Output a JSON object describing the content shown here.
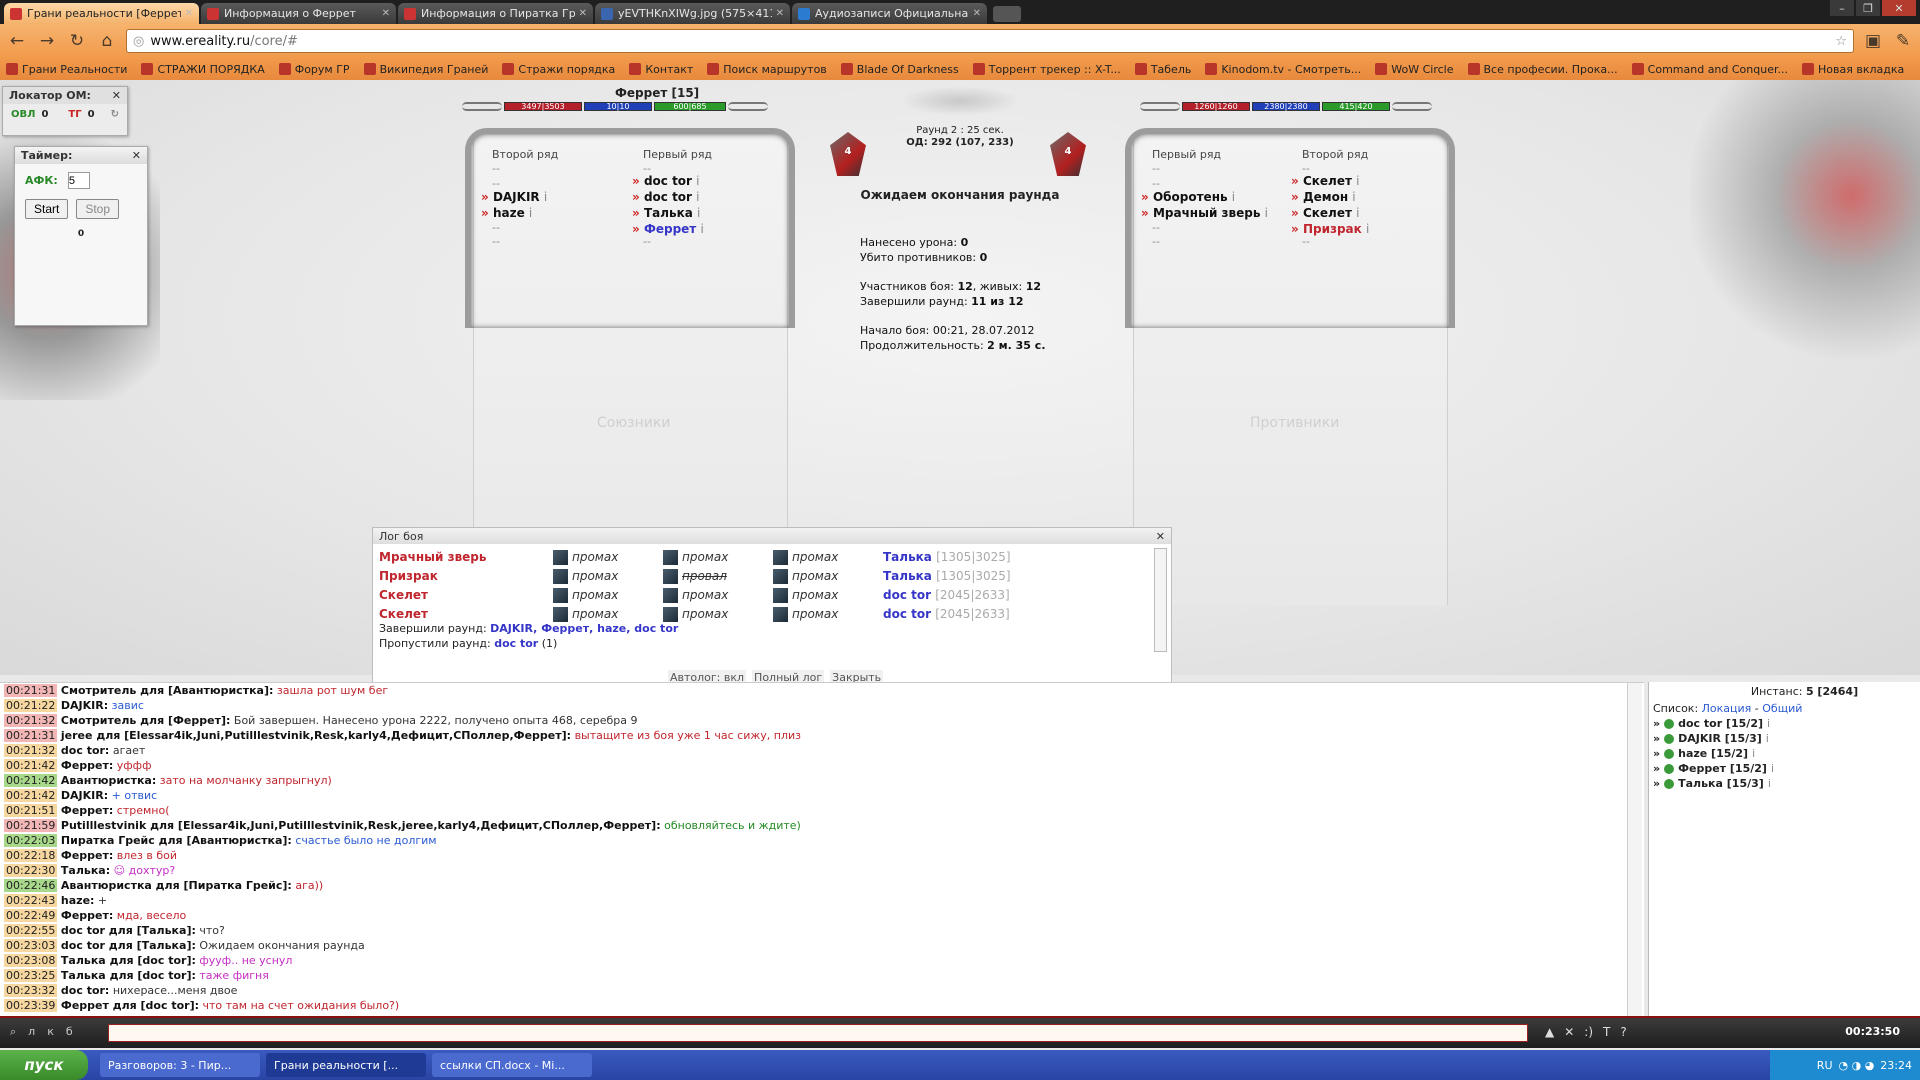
{
  "browser": {
    "tabs": [
      {
        "label": "Грани реальности [Феррет]",
        "active": true,
        "icon": "grani-favicon"
      },
      {
        "label": "Информация о Феррет",
        "active": false,
        "icon": "grani-favicon"
      },
      {
        "label": "Информация о Пиратка Гр",
        "active": false,
        "icon": "grani-favicon"
      },
      {
        "label": "yEVTHKnXIWg.jpg (575×411",
        "active": false,
        "icon": "vk-favicon"
      },
      {
        "label": "Аудиозаписи Официальная",
        "active": false,
        "icon": "vk-favicon"
      }
    ],
    "url_host": "www.ereality.ru",
    "url_path": "/core/#",
    "bookmarks": [
      "Грани Реальности",
      "СТРАЖИ ПОРЯДКА",
      "Форум ГР",
      "Википедия Граней",
      "Стражи порядка",
      "Контакт",
      "Поиск маршрутов",
      "Blade Of Darkness",
      "Торрент трекер :: X-T...",
      "Табель",
      "Kinodom.tv - Смотреть...",
      "WoW Circle",
      "Все професии. Прока...",
      "Command and Conquer...",
      "Новая вкладка"
    ]
  },
  "locator": {
    "title": "Локатор ОМ:",
    "ovl_label": "ОВЛ",
    "ovl_value": "0",
    "tg_label": "ТГ",
    "tg_value": "0"
  },
  "timer": {
    "title": "Таймер:",
    "afk_label": "АФК:",
    "afk_value": "5",
    "start": "Start",
    "stop": "Stop",
    "counter": "0"
  },
  "battle": {
    "player_title": "Феррет [15]",
    "left_bars": {
      "hp": "3497|3503",
      "mana": "10|10",
      "energy": "600|685"
    },
    "right_bars": {
      "hp": "1260|1260",
      "mana": "2380|2380",
      "energy": "415|420"
    },
    "team_left_count": "4",
    "team_right_count": "4",
    "round_line": "Раунд 2 : 25 сек.",
    "od_line": "ОД: 292 (107, 233)",
    "status": "Ожидаем окончания раунда",
    "stats": {
      "damage_label": "Нанесено урона:",
      "damage": "0",
      "kills_label": "Убито противников:",
      "kills": "0",
      "participants_label": "Участников боя:",
      "participants": "12",
      "alive_label": ", живых:",
      "alive": "12",
      "finished_label": "Завершили раунд:",
      "finished": "11 из 12",
      "start_label": "Начало боя:",
      "start": "00:21, 28.07.2012",
      "duration_label": "Продолжительность:",
      "duration": "2 м. 35 с."
    },
    "allies": {
      "second_row": "Второй ряд",
      "first_row": "Первый ряд",
      "second": [
        "--",
        "--",
        "DAJKIR",
        "haze",
        "--",
        "--"
      ],
      "first": [
        "--",
        "doc tor",
        "doc tor",
        "Талька",
        "Феррет",
        "--"
      ],
      "watermark": "Союзники"
    },
    "enemies": {
      "first_row": "Первый ряд",
      "second_row": "Второй ряд",
      "first": [
        "--",
        "--",
        "Оборотень",
        "Мрачный зверь",
        "--",
        "--"
      ],
      "second": [
        "--",
        "Скелет",
        "Демон",
        "Скелет",
        "Призрак",
        "--"
      ],
      "watermark": "Противники"
    }
  },
  "log": {
    "title": "Лог боя",
    "rows": [
      {
        "name": "Мрачный зверь",
        "a": "промах",
        "b": "промах",
        "c": "промах",
        "target": "Талька",
        "hp": "[1305|3025]"
      },
      {
        "name": "Призрак",
        "a": "промах",
        "b": "провал",
        "c": "промах",
        "target": "Талька",
        "hp": "[1305|3025]"
      },
      {
        "name": "Скелет",
        "a": "промах",
        "b": "промах",
        "c": "промах",
        "target": "doc tor",
        "hp": "[2045|2633]"
      },
      {
        "name": "Скелет",
        "a": "промах",
        "b": "промах",
        "c": "промах",
        "target": "doc tor",
        "hp": "[2045|2633]"
      }
    ],
    "finished_label": "Завершили раунд:",
    "finished_names": "DAJKIR, Феррет, haze, doc tor",
    "skipped_label": "Пропустили раунд:",
    "skipped_names": "doc tor",
    "skipped_count": "(1)",
    "footer": [
      "Автолог: вкл",
      "Полный лог",
      "Закрыть"
    ]
  },
  "chat": [
    {
      "t": "00:21:31",
      "c": "r",
      "n": "Смотритель для [Авантюристка]:",
      "m": "зашла рот шум бег",
      "k": ""
    },
    {
      "t": "00:21:22",
      "c": "",
      "n": "DAJKIR:",
      "m": "завис",
      "k": "b"
    },
    {
      "t": "00:21:32",
      "c": "r",
      "n": "Смотритель для [Феррет]:",
      "m": "Бой завершен. Нанесено урона 2222, получено опыта 468, серебра 9",
      "k": "d"
    },
    {
      "t": "00:21:31",
      "c": "r",
      "n": "jeree для [Elessar4ik,Juni,Putilllestvinik,Resk,karly4,Дефицит,СПоллер,Феррет]:",
      "m": "вытащите из боя уже 1 час сижу, плиз",
      "k": ""
    },
    {
      "t": "00:21:32",
      "c": "",
      "n": "doc tor:",
      "m": "агает",
      "k": "d"
    },
    {
      "t": "00:21:42",
      "c": "",
      "n": "Феррет:",
      "m": "уффф",
      "k": ""
    },
    {
      "t": "00:21:42",
      "c": "g",
      "n": "Авантюристка:",
      "m": "зато на молчанку запрыгнул)",
      "k": ""
    },
    {
      "t": "00:21:42",
      "c": "",
      "n": "DAJKIR:",
      "m": "+ отвис",
      "k": "b"
    },
    {
      "t": "00:21:51",
      "c": "",
      "n": "Феррет:",
      "m": "стремно(",
      "k": ""
    },
    {
      "t": "00:21:59",
      "c": "r",
      "n": "Putilllestvinik для [Elessar4ik,Juni,Putilllestvinik,Resk,jeree,karly4,Дефицит,СПоллер,Феррет]:",
      "m": "обновляйтесь и ждите)",
      "k": "gr"
    },
    {
      "t": "00:22:03",
      "c": "g",
      "n": "Пиратка Грейс для [Авантюристка]:",
      "m": "счастье было не долгим",
      "k": "b"
    },
    {
      "t": "00:22:18",
      "c": "",
      "n": "Феррет:",
      "m": "влез в бой",
      "k": ""
    },
    {
      "t": "00:22:30",
      "c": "",
      "n": "Талька:",
      "m": "☺ дохтур?",
      "k": "p"
    },
    {
      "t": "00:22:46",
      "c": "g",
      "n": "Авантюристка для [Пиратка Грейс]:",
      "m": "ага))",
      "k": ""
    },
    {
      "t": "00:22:43",
      "c": "",
      "n": "haze:",
      "m": "+",
      "k": "d"
    },
    {
      "t": "00:22:49",
      "c": "",
      "n": "Феррет:",
      "m": "мда, весело",
      "k": ""
    },
    {
      "t": "00:22:55",
      "c": "",
      "n": "doc tor для [Талька]:",
      "m": "что?",
      "k": "d"
    },
    {
      "t": "00:23:03",
      "c": "",
      "n": "doc tor для [Талька]:",
      "m": "Ожидаем окончания раунда",
      "k": "d"
    },
    {
      "t": "00:23:08",
      "c": "",
      "n": "Талька для [doc tor]:",
      "m": "фууф.. не уснул",
      "k": "p"
    },
    {
      "t": "00:23:25",
      "c": "",
      "n": "Талька для [doc tor]:",
      "m": "таже фигня",
      "k": "p"
    },
    {
      "t": "00:23:32",
      "c": "",
      "n": "doc tor:",
      "m": "нихерасе...меня двое",
      "k": "d"
    },
    {
      "t": "00:23:39",
      "c": "",
      "n": "Феррет для [doc tor]:",
      "m": "что там на счет ожидания было?)",
      "k": ""
    }
  ],
  "roster": {
    "instance_label": "Инстанс:",
    "instance_value": "5 [2464]",
    "list_label": "Список:",
    "location": "Локация",
    "general": "Общий",
    "players": [
      "doc tor [15/2]",
      "DAJKIR [15/3]",
      "haze [15/2]",
      "Феррет [15/2]",
      "Талька [15/3]"
    ]
  },
  "bottom": {
    "clock": "00:23:50"
  },
  "taskbar": {
    "start": "пуск",
    "tasks": [
      "Разговоров: 3 - Пир...",
      "Грани реальности [...",
      "ссылки СП.docx - Mi..."
    ],
    "lang": "RU",
    "time": "23:24"
  }
}
